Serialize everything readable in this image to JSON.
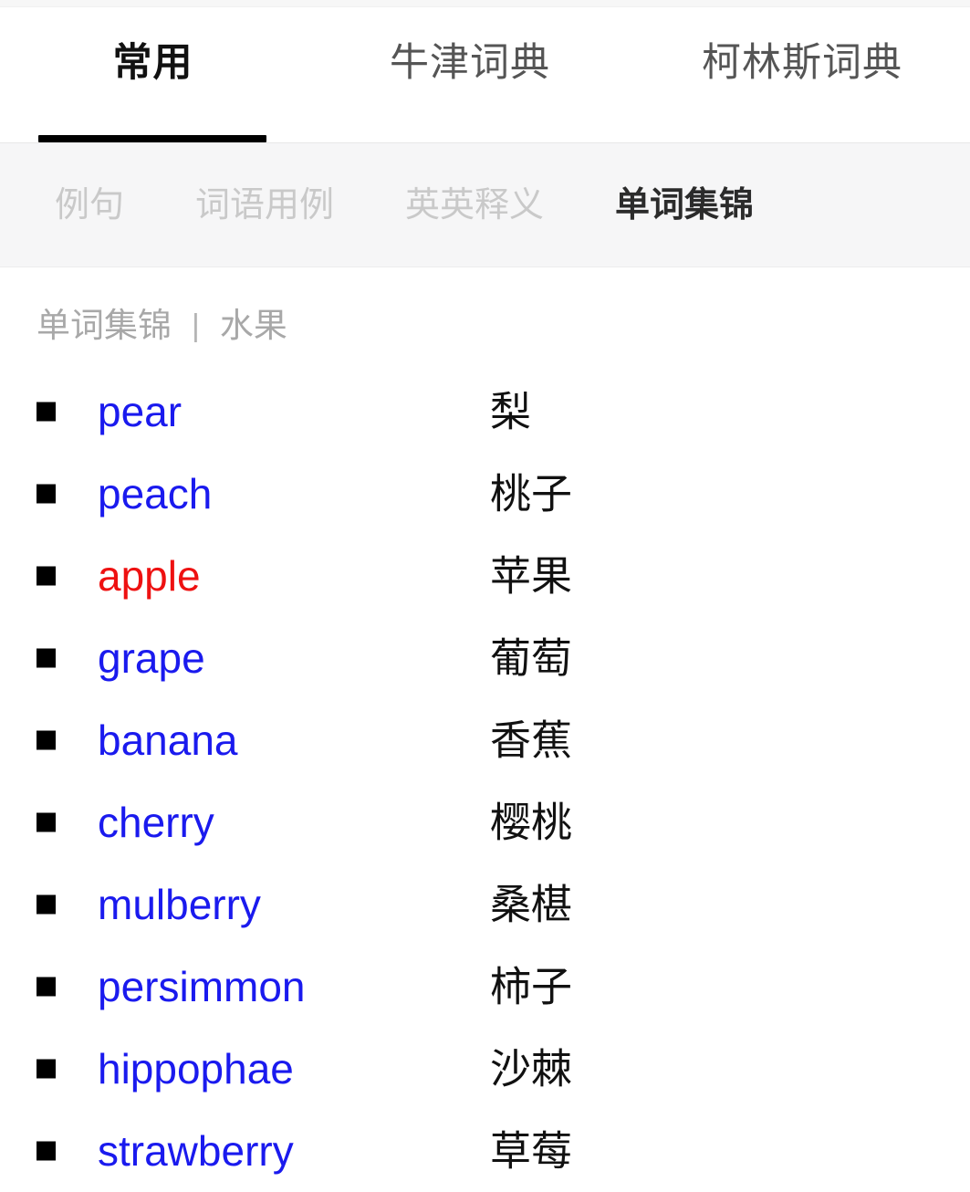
{
  "colors": {
    "link": "#1a1aee",
    "current_word": "#ee1111",
    "active_tab": "#111111",
    "inactive_tab": "#555555",
    "section_inactive": "#c9c9c9",
    "section_active": "#2b2b2b",
    "breadcrumb": "#a8a8a8",
    "section_bar_bg": "#f6f6f7",
    "underline": "#000000",
    "bullet": "#000000",
    "page_bg": "#ffffff"
  },
  "dictionary_tabs": [
    {
      "label": "常用",
      "active": true
    },
    {
      "label": "牛津词典",
      "active": false
    },
    {
      "label": "柯林斯词典",
      "active": false
    }
  ],
  "section_tabs": [
    {
      "label": "例句",
      "active": false
    },
    {
      "label": "词语用例",
      "active": false
    },
    {
      "label": "英英释义",
      "active": false
    },
    {
      "label": "单词集锦",
      "active": true
    }
  ],
  "breadcrumb": {
    "root": "单词集锦",
    "separator": "|",
    "category": "水果"
  },
  "word_list": [
    {
      "en": "pear",
      "zh": "梨",
      "current": false
    },
    {
      "en": "peach",
      "zh": "桃子",
      "current": false
    },
    {
      "en": "apple",
      "zh": "苹果",
      "current": true
    },
    {
      "en": "grape",
      "zh": "葡萄",
      "current": false
    },
    {
      "en": "banana",
      "zh": "香蕉",
      "current": false
    },
    {
      "en": "cherry",
      "zh": "樱桃",
      "current": false
    },
    {
      "en": "mulberry",
      "zh": "桑椹",
      "current": false
    },
    {
      "en": "persimmon",
      "zh": "柿子",
      "current": false
    },
    {
      "en": "hippophae",
      "zh": "沙棘",
      "current": false
    },
    {
      "en": "strawberry",
      "zh": "草莓",
      "current": false
    }
  ]
}
